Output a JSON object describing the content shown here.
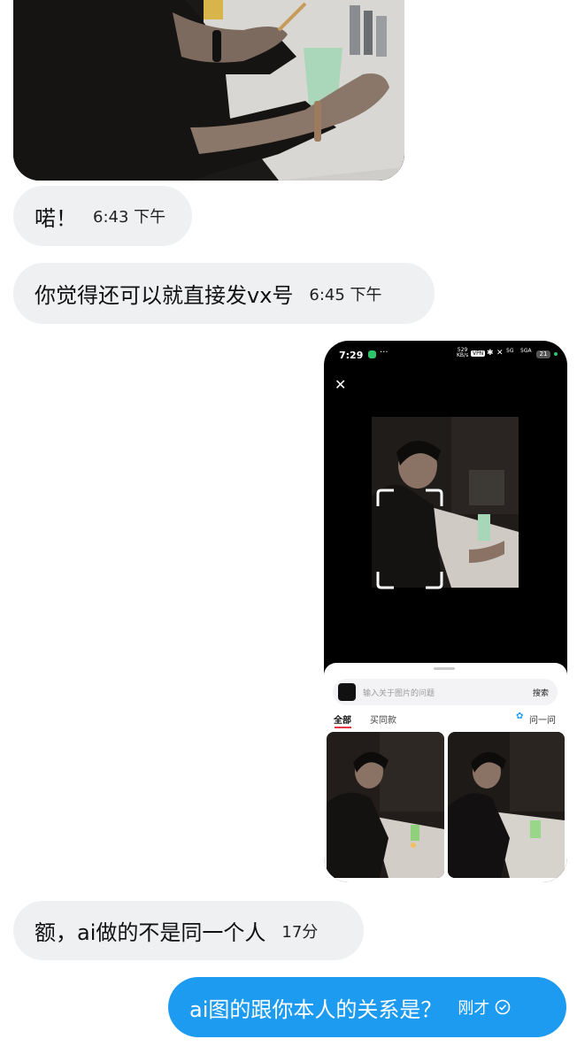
{
  "messages": [
    {
      "text": "喏！",
      "time": "6:43 下午"
    },
    {
      "text": "你觉得还可以就直接发vx号",
      "time": "6:45 下午"
    },
    {
      "text": "额，ai做的不是同一个人",
      "time": "17分"
    },
    {
      "text": "ai图的跟你本人的关系是？",
      "time": "刚才"
    }
  ],
  "screenshot": {
    "status_time": "7:29",
    "net_speed_value": "529",
    "net_speed_unit": "KB/s",
    "vpn_label": "VPN",
    "signal_5g": "5G",
    "signal_5ga": "5GA",
    "battery_level": "21",
    "search_placeholder": "输入关于图片的问题",
    "search_button": "搜索",
    "tabs": [
      "全部",
      "买同款"
    ],
    "ask_label": "问一问"
  },
  "colors": {
    "incoming_bubble": "#eef0f2",
    "outgoing_bubble": "#1d9bf0",
    "tab_underline": "#e8334a"
  },
  "icons": [
    "close-icon",
    "scan-frame-icon",
    "settings-icon",
    "read-check-icon"
  ]
}
